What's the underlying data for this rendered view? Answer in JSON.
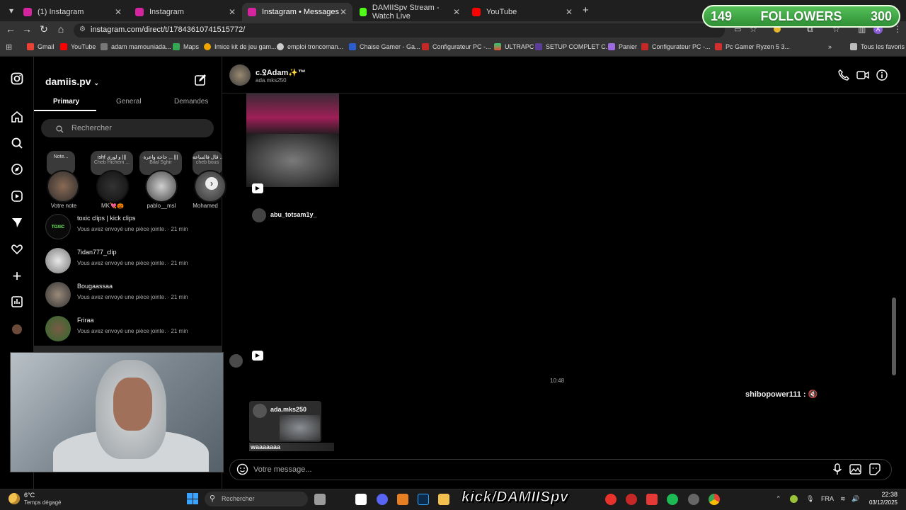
{
  "browser": {
    "tabs": [
      {
        "label": "(1) Instagram",
        "color": "#d6249f"
      },
      {
        "label": "Instagram",
        "color": "#d6249f"
      },
      {
        "label": "Instagram • Messages",
        "color": "#d6249f"
      },
      {
        "label": "DAMIISpv Stream - Watch Live",
        "color": "#53fc18"
      },
      {
        "label": "YouTube",
        "color": "#ff0000"
      }
    ],
    "url": "instagram.com/direct/t/17843610741515772/",
    "bookmarks": [
      "Gmail",
      "YouTube",
      "adam mamouniada...",
      "Maps",
      "Imice kit de jeu gam...",
      "emploi troncoman...",
      "Chaise Gamer - Ga...",
      "Configurateur PC -...",
      "ULTRAPC",
      "SETUP COMPLET C...",
      "Panier",
      "Configurateur PC -...",
      "Pc Gamer Ryzen 5 3...",
      "Tous les favoris"
    ]
  },
  "overlay": {
    "followers_current": "149",
    "followers_label": "FOLLOWERS",
    "followers_goal": "300"
  },
  "inbox": {
    "username": "damiis.pv",
    "tabs": [
      "Primary",
      "General",
      "Demandes"
    ],
    "search_placeholder": "Rechercher",
    "notes": [
      {
        "text": "Note..."
      },
      {
        "text": "ishf و لوري |||",
        "sub": "Cheb Hichem ..."
      },
      {
        "text": "حاجة واعرة ... |||",
        "sub": "Bilal Sghir"
      },
      {
        "text": "قال فالساعة ... |||",
        "sub": "cheb bous"
      }
    ],
    "stories": [
      "Votre note",
      "MK💘🎃",
      "pablo__msl",
      "Mohamed"
    ],
    "conversations": [
      {
        "name": "toxic clips | kick clips",
        "sub": "Vous avez envoyé une pièce jointe. · 21 min"
      },
      {
        "name": "7idan777_clip",
        "sub": "Vous avez envoyé une pièce jointe. · 21 min"
      },
      {
        "name": "Bougaassaa",
        "sub": "Vous avez envoyé une pièce jointe. · 21 min"
      },
      {
        "name": "Friraa",
        "sub": "Vous avez envoyé une pièce jointe. · 21 min"
      }
    ]
  },
  "chat": {
    "name": "c.ꝾAdam✨™",
    "handle": "ada.mks250",
    "shared_account": "abu_totsam1y_",
    "timestamp": "10:48",
    "overlay_text": "shibopower111 :",
    "reply_name": "ada.mks250",
    "reply_text": "waaaaaaa",
    "composer_placeholder": "Votre message..."
  },
  "taskbar": {
    "weather_temp": "6°C",
    "weather_text": "Temps dégagé",
    "search_placeholder": "Rechercher",
    "kick_banner": "kick/DAMIISpv",
    "lang": "FRA",
    "time": "22:38",
    "date": "03/12/2025"
  }
}
